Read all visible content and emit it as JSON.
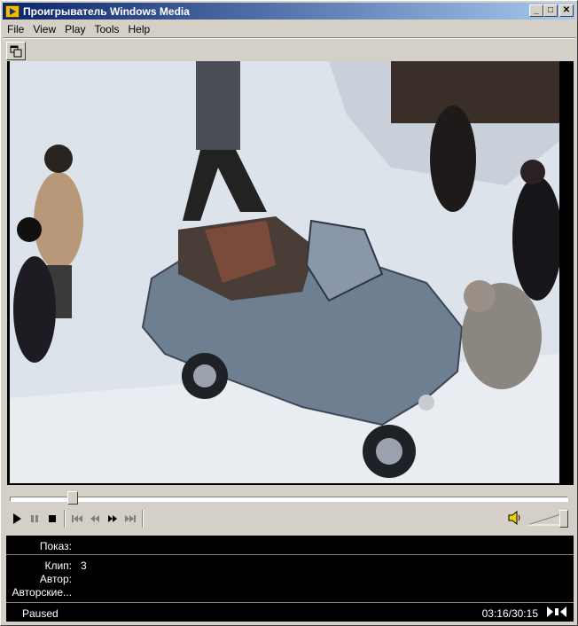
{
  "window": {
    "title": "Проигрыватель Windows Media",
    "minimize": "_",
    "maximize": "□",
    "close": "✕"
  },
  "menu": [
    {
      "label": "File"
    },
    {
      "label": "View"
    },
    {
      "label": "Play"
    },
    {
      "label": "Tools"
    },
    {
      "label": "Help"
    }
  ],
  "playback": {
    "progress_fraction": 0.1056,
    "volume_fraction": 1.0
  },
  "info": {
    "show_label": "Показ:",
    "show_value": "",
    "clip_label": "Клип:",
    "clip_value": "3",
    "author_label": "Автор:",
    "author_value": "",
    "copyright_label": "Авторские...",
    "copyright_value": ""
  },
  "status": {
    "state": "Paused",
    "time": "03:16/30:15"
  },
  "icons": {
    "app": "media-player-icon",
    "compact_mode": "compact-mode-icon",
    "play": "play-icon",
    "pause": "pause-icon",
    "stop": "stop-icon",
    "skip_back": "skip-back-icon",
    "rewind": "rewind-icon",
    "fast_forward": "fast-forward-icon",
    "skip_forward": "skip-forward-icon",
    "volume": "speaker-icon"
  }
}
